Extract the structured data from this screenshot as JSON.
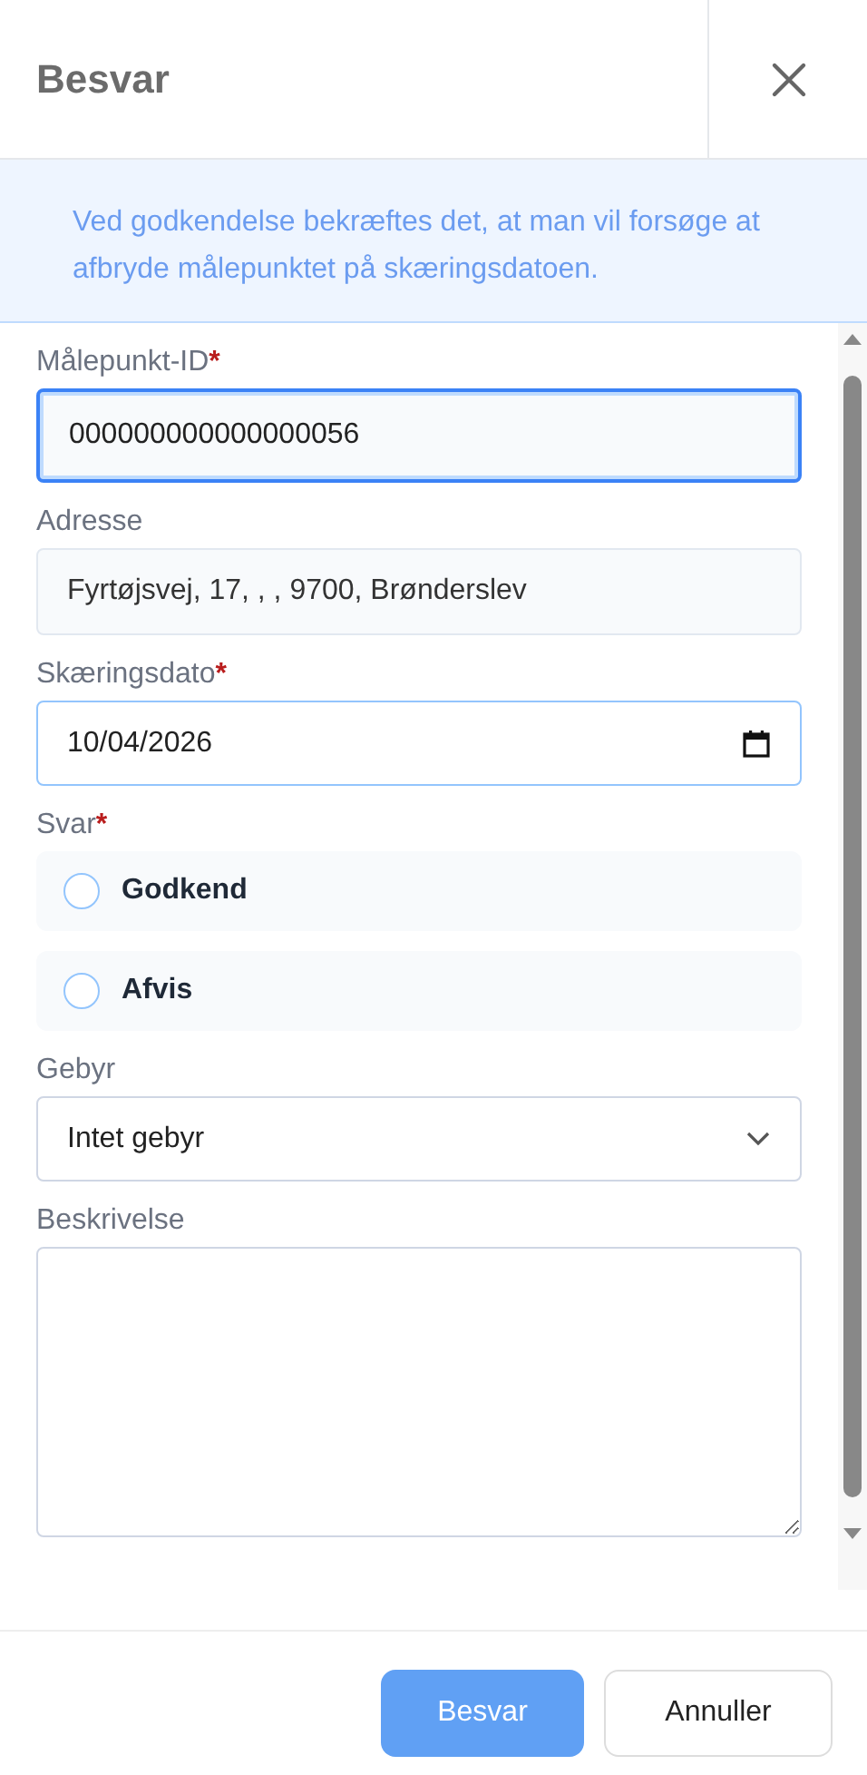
{
  "dialog": {
    "title": "Besvar"
  },
  "info": "Ved godkendelse bekræftes det, at man vil forsøge at afbryde målepunktet på skæringsdatoen.",
  "required_mark": "*",
  "fields": [
    {
      "kind": "text",
      "label": "Målepunkt-ID",
      "required": true,
      "value": "000000000000000056",
      "focused": true
    },
    {
      "kind": "readonly",
      "label": "Adresse",
      "required": false,
      "value": "Fyrtøjsvej, 17, , , 9700, Brønderslev",
      "focused": false
    },
    {
      "kind": "date",
      "label": "Skæringsdato",
      "required": true,
      "value": "10/04/2026",
      "focused": false
    },
    {
      "kind": "radio",
      "label": "Svar",
      "required": true,
      "options": [
        {
          "label": "Godkend",
          "selected": false
        },
        {
          "label": "Afvis",
          "selected": false
        }
      ]
    },
    {
      "kind": "select",
      "label": "Gebyr",
      "required": false,
      "value": "Intet gebyr",
      "focused": false
    },
    {
      "kind": "textarea",
      "label": "Beskrivelse",
      "required": false,
      "focused": false
    }
  ],
  "buttons": [
    {
      "label": "Besvar",
      "kind": "primary"
    },
    {
      "label": "Annuller",
      "kind": "secondary"
    }
  ]
}
